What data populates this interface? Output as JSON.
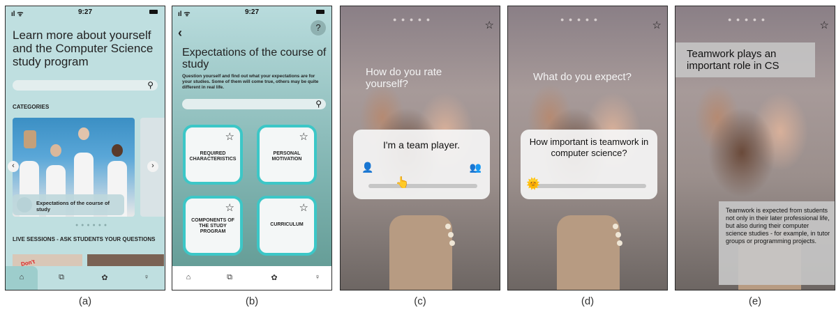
{
  "status": {
    "time": "9:27",
    "signal": "ıl ᯤ"
  },
  "screen_a": {
    "title": "Learn more about yourself and the Computer Science study program",
    "categories_label": "CATEGORIES",
    "card_label": "Expectations of the course of study",
    "live_label": "LIVE SESSIONS - ASK STUDENTS YOUR QUESTIONS",
    "thumb_text": "Don't",
    "caption": "(a)"
  },
  "screen_b": {
    "title": "Expectations of the course of study",
    "description": "Question yourself and find out what your expectations are for your studies. Some of them will come true, others may be quite different in real life.",
    "help": "?",
    "tiles": [
      "REQUIRED CHARACTERISTICS",
      "PERSONAL MOTIVATION",
      "COMPONENTS OF THE STUDY PROGRAM",
      "CURRICULUM"
    ],
    "caption": "(b)"
  },
  "screen_c": {
    "question": "How do you rate yourself?",
    "statement": "I'm a team player.",
    "slider_level": 0.3,
    "caption": "(c)"
  },
  "screen_d": {
    "question": "What do you expect?",
    "statement": "How important is teamwork in computer science?",
    "slider_level": 0.0,
    "caption": "(d)"
  },
  "screen_e": {
    "title": "Teamwork plays an important role in CS",
    "body": "Teamwork is expected from students not only in their later professional life, but also during their computer science studies - for example, in tutor groups or programming projects.",
    "caption": "(e)"
  },
  "icons": {
    "search": "⚲",
    "star": "☆",
    "home": "⌂",
    "back": "‹",
    "prev": "‹",
    "next": "›"
  }
}
